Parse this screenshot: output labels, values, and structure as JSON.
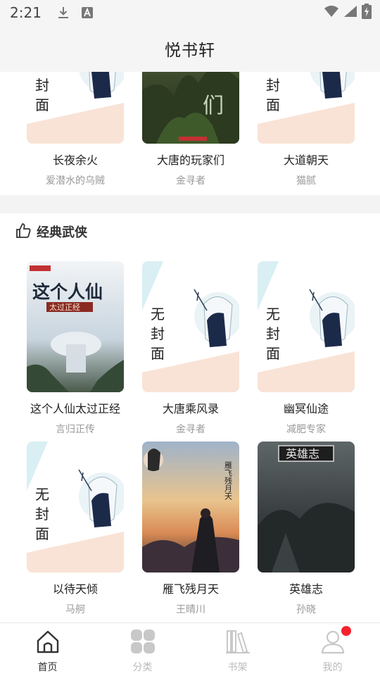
{
  "status_bar": {
    "time": "2:21",
    "icons": [
      "download-icon",
      "font-a-icon",
      "wifi-icon",
      "signal-icon",
      "battery-charging-icon"
    ]
  },
  "header": {
    "title": "悦书轩"
  },
  "top_row": [
    {
      "title": "长夜余火",
      "author": "爱潜水的乌贼",
      "cover": "placeholder"
    },
    {
      "title": "大唐的玩家们",
      "author": "金寻者",
      "cover": "art-forest"
    },
    {
      "title": "大道朝天",
      "author": "猫腻",
      "cover": "placeholder"
    }
  ],
  "section": {
    "title": "经典武侠",
    "icon": "thumbs-up-icon"
  },
  "books_row1": [
    {
      "title": "这个人仙太过正经",
      "author": "言归正传",
      "cover": "art-immortal"
    },
    {
      "title": "大唐乘风录",
      "author": "金寻者",
      "cover": "placeholder"
    },
    {
      "title": "幽冥仙途",
      "author": "减肥专家",
      "cover": "placeholder"
    }
  ],
  "books_row2": [
    {
      "title": "以待天倾",
      "author": "马舸",
      "cover": "placeholder"
    },
    {
      "title": "雁飞残月天",
      "author": "王晴川",
      "cover": "art-sunset"
    },
    {
      "title": "英雄志",
      "author": "孙晓",
      "cover": "art-dark"
    }
  ],
  "placeholder_cover": {
    "line1": "无",
    "line2": "封",
    "line3": "面"
  },
  "cover_text": {
    "forest": "们",
    "immortal_title": "这个人仙",
    "immortal_sub": "太过正经",
    "sunset_title": "雁飞残月天",
    "dark_title": "英雄志"
  },
  "bottom_nav": [
    {
      "label": "首页",
      "icon": "home-icon",
      "active": true
    },
    {
      "label": "分类",
      "icon": "grid-icon",
      "active": false
    },
    {
      "label": "书架",
      "icon": "bookshelf-icon",
      "active": false
    },
    {
      "label": "我的",
      "icon": "user-icon",
      "active": false,
      "badge": true
    }
  ],
  "colors": {
    "accent": "#f5222d",
    "placeholder_bg": "#d8eef2",
    "placeholder_band": "#f9e3d6"
  }
}
